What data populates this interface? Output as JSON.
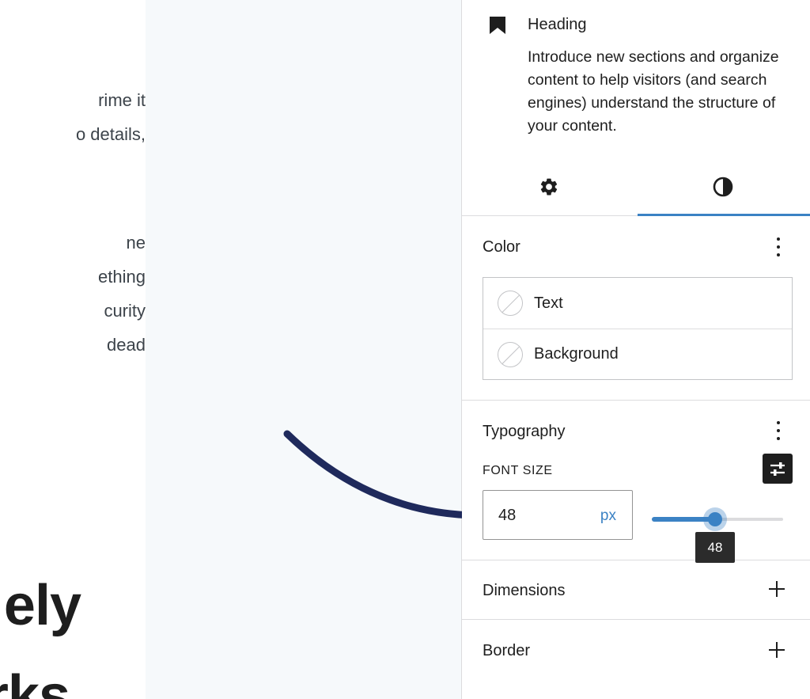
{
  "canvas": {
    "paragraph_1": [
      "rime it",
      "o details,"
    ],
    "paragraph_2": [
      "ne",
      "ething",
      "curity",
      "dead"
    ],
    "heading_lines": [
      "ely",
      "rks"
    ]
  },
  "block": {
    "icon": "bookmark-icon",
    "title": "Heading",
    "description": "Introduce new sections and organize content to help visitors (and search engines) understand the structure of your content."
  },
  "tabs": [
    {
      "icon": "gear-icon",
      "name": "Settings",
      "active": false
    },
    {
      "icon": "contrast-icon",
      "name": "Styles",
      "active": true
    }
  ],
  "color_panel": {
    "title": "Color",
    "items": [
      {
        "label": "Text"
      },
      {
        "label": "Background"
      }
    ]
  },
  "typography_panel": {
    "title": "Typography",
    "font_size_label": "FONT SIZE",
    "font_size_value": "48",
    "unit": "px",
    "slider_fraction": 0.48,
    "tooltip": "48"
  },
  "dimensions_panel": {
    "title": "Dimensions"
  },
  "border_panel": {
    "title": "Border"
  },
  "colors": {
    "accent": "#3b82c4",
    "annotation_arrow": "#1f2a5c"
  }
}
